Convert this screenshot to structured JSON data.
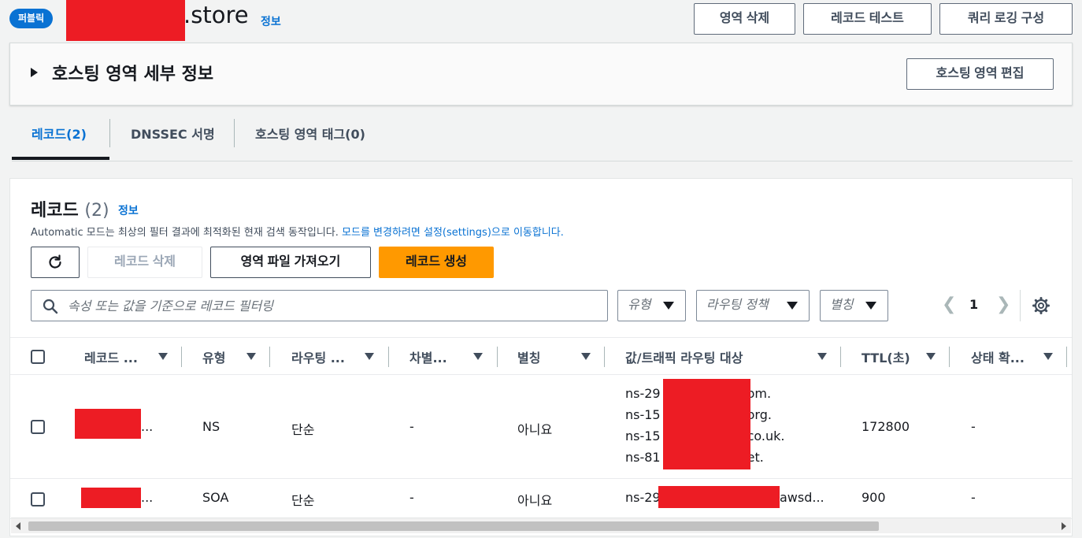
{
  "header": {
    "badge": "퍼블릭",
    "title_suffix": ".store",
    "info_link": "정보",
    "buttons": {
      "delete_zone": "영역 삭제",
      "test_record": "레코드 테스트",
      "query_logging": "쿼리 로깅 구성"
    }
  },
  "details": {
    "title": "호스팅 영역 세부 정보",
    "edit_button": "호스팅 영역 편집"
  },
  "tabs": {
    "records": "레코드(2)",
    "dnssec": "DNSSEC 서명",
    "tags": "호스팅 영역 태그(0)"
  },
  "records": {
    "title": "레코드",
    "count": "(2)",
    "info_link": "정보",
    "description": "Automatic 모드는 최상의 필터 결과에 최적화된 현재 검색 동작입니다.",
    "description_link": "모드를 변경하려면 설정(settings)으로 이동합니다.",
    "buttons": {
      "delete": "레코드 삭제",
      "import": "영역 파일 가져오기",
      "create": "레코드 생성"
    },
    "search_placeholder": "속성 또는 값을 기준으로 레코드 필터링",
    "filters": {
      "type": "유형",
      "routing": "라우팅 정책",
      "alias": "별칭"
    },
    "page": "1"
  },
  "table": {
    "columns": [
      "레코드 ...",
      "유형",
      "라우팅 ...",
      "차별...",
      "별칭",
      "값/트래픽 라우팅 대상",
      "TTL(초)",
      "상태 확..."
    ],
    "rows": [
      {
        "name_suffix": "...",
        "type": "NS",
        "routing": "단순",
        "differentiator": "-",
        "alias": "아니요",
        "values": [
          {
            "prefix": "ns-29",
            "suffix": "om."
          },
          {
            "prefix": "ns-15",
            "suffix": "org."
          },
          {
            "prefix": "ns-15",
            "suffix": "co.uk."
          },
          {
            "prefix": "ns-81",
            "suffix": "et."
          }
        ],
        "ttl": "172800",
        "health": "-"
      },
      {
        "name_suffix": "...",
        "type": "SOA",
        "routing": "단순",
        "differentiator": "-",
        "alias": "아니요",
        "value_prefix": "ns-29",
        "value_suffix": "awsd...",
        "ttl": "900",
        "health": "-"
      }
    ]
  },
  "colors": {
    "primary": "#ff9900",
    "link": "#0972d3",
    "redaction": "#ed1c24"
  }
}
